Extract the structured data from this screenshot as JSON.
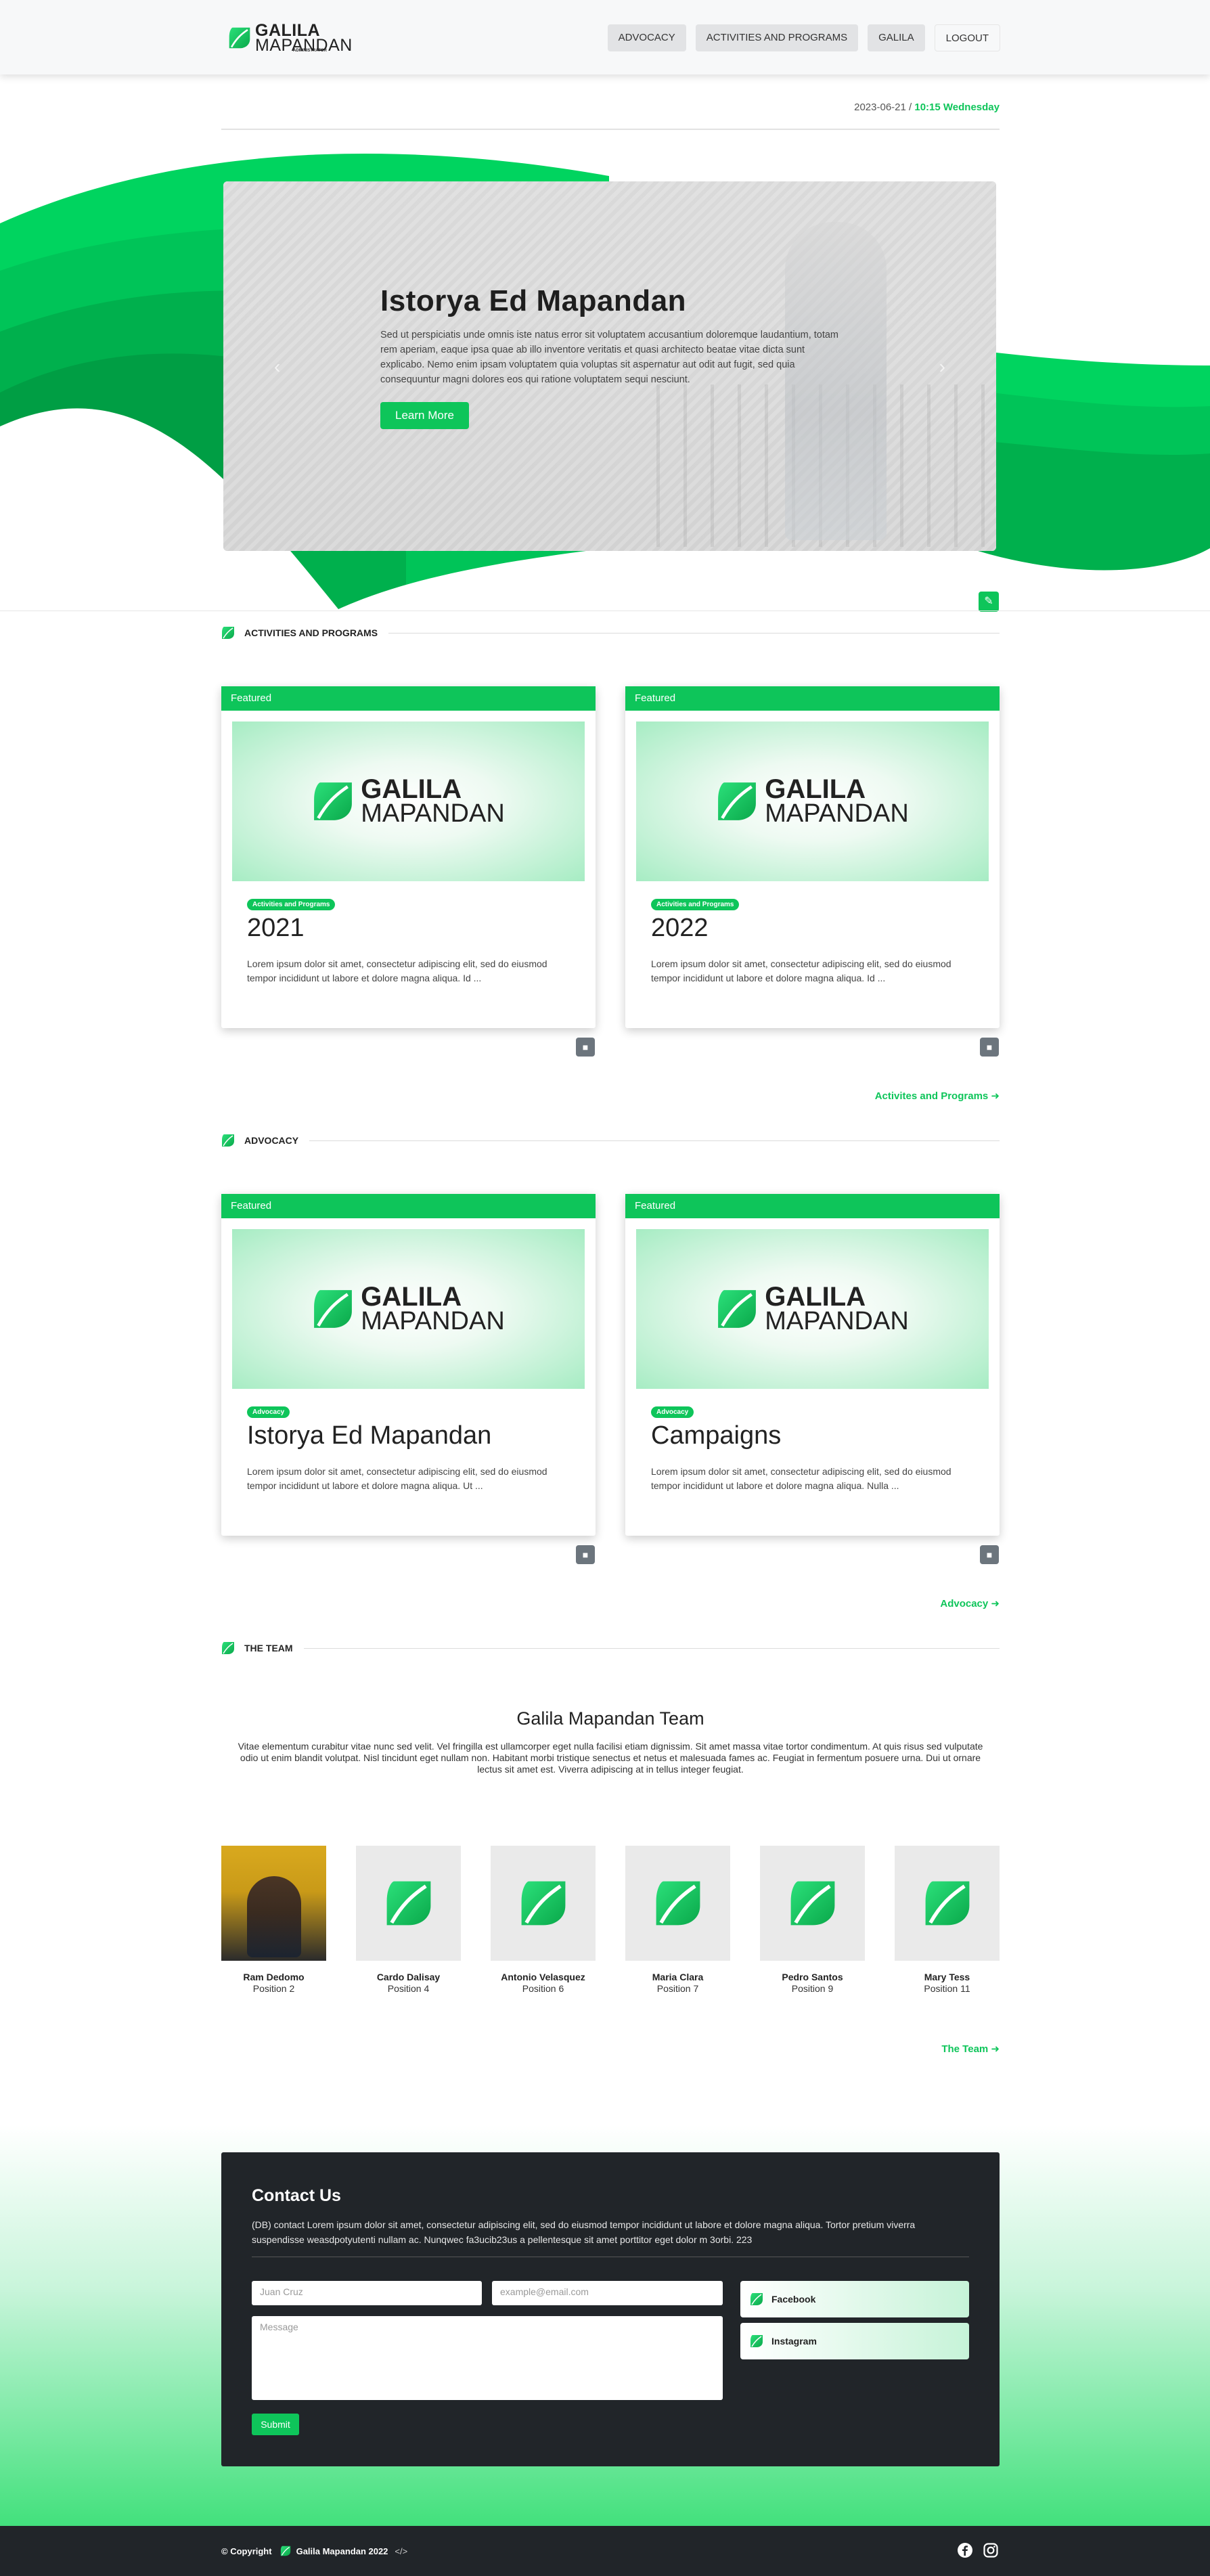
{
  "brand": {
    "line1": "GALILA",
    "line2": "MAPANDAN",
    "sub": "ADMINISTRATOR"
  },
  "nav": {
    "advocacy": "ADVOCACY",
    "activities": "ACTIVITIES AND PROGRAMS",
    "galila": "GALILA",
    "logout": "LOGOUT"
  },
  "datebar": {
    "date": "2023-06-21",
    "sep": " / ",
    "time": "10:15 Wednesday"
  },
  "hero": {
    "title": "Istorya Ed Mapandan",
    "text": "Sed ut perspiciatis unde omnis iste natus error sit voluptatem accusantium doloremque laudantium, totam rem aperiam, eaque ipsa quae ab illo inventore veritatis et quasi architecto beatae vitae dicta sunt explicabo. Nemo enim ipsam voluptatem quia voluptas sit aspernatur aut odit aut fugit, sed quia consequuntur magni dolores eos qui ratione voluptatem sequi nesciunt.",
    "button": "Learn More",
    "prev": "‹",
    "next": "›"
  },
  "sections": {
    "activities": {
      "label": "ACTIVITIES AND PROGRAMS",
      "more": "Activites and Programs",
      "cards": [
        {
          "ribbon": "Featured",
          "logo1": "GALILA",
          "logo2": "MAPANDAN",
          "badge": "Activities and Programs",
          "title": "2021",
          "desc": "Lorem ipsum dolor sit amet, consectetur adipiscing elit, sed do eiusmod tempor incididunt ut labore et dolore magna aliqua. Id ..."
        },
        {
          "ribbon": "Featured",
          "logo1": "GALILA",
          "logo2": "MAPANDAN",
          "badge": "Activities and Programs",
          "title": "2022",
          "desc": "Lorem ipsum dolor sit amet, consectetur adipiscing elit, sed do eiusmod tempor incididunt ut labore et dolore magna aliqua. Id ..."
        }
      ]
    },
    "advocacy": {
      "label": "ADVOCACY",
      "more": "Advocacy",
      "cards": [
        {
          "ribbon": "Featured",
          "logo1": "GALILA",
          "logo2": "MAPANDAN",
          "badge": "Advocacy",
          "title": "Istorya Ed Mapandan",
          "desc": "Lorem ipsum dolor sit amet, consectetur adipiscing elit, sed do eiusmod tempor incididunt ut labore et dolore magna aliqua. Ut ..."
        },
        {
          "ribbon": "Featured",
          "logo1": "GALILA",
          "logo2": "MAPANDAN",
          "badge": "Advocacy",
          "title": "Campaigns",
          "desc": "Lorem ipsum dolor sit amet, consectetur adipiscing elit, sed do eiusmod tempor incididunt ut labore et dolore magna aliqua. Nulla ..."
        }
      ]
    },
    "team": {
      "label": "THE TEAM",
      "title": "Galila Mapandan Team",
      "desc": "Vitae elementum curabitur vitae nunc sed velit. Vel fringilla est ullamcorper eget nulla facilisi etiam dignissim. Sit amet massa vitae tortor condimentum. At quis risus sed vulputate odio ut enim blandit volutpat. Nisl tincidunt eget nullam non. Habitant morbi tristique senectus et netus et malesuada fames ac. Feugiat in fermentum posuere urna. Dui ut ornare lectus sit amet est. Viverra adipiscing at in tellus integer feugiat.",
      "more": "The Team",
      "members": [
        {
          "name": "Ram Dedomo",
          "position": "Position 2"
        },
        {
          "name": "Cardo Dalisay",
          "position": "Position 4"
        },
        {
          "name": "Antonio Velasquez",
          "position": "Position 6"
        },
        {
          "name": "Maria Clara",
          "position": "Position 7"
        },
        {
          "name": "Pedro Santos",
          "position": "Position 9"
        },
        {
          "name": "Mary Tess",
          "position": "Position 11"
        }
      ]
    }
  },
  "contact": {
    "title": "Contact Us",
    "text": "(DB) contact Lorem ipsum dolor sit amet, consectetur adipiscing elit, sed do eiusmod tempor incididunt ut labore et dolore magna aliqua. Tortor pretium viverra suspendisse weasdpotyutenti nullam ac. Nunqwec fa3ucib23us a pellentesque sit amet porttitor eget dolor m 3orbi. 223",
    "name_placeholder": "Juan Cruz",
    "email_placeholder": "example@email.com",
    "message_placeholder": "Message",
    "submit": "Submit",
    "facebook": "Facebook",
    "instagram": "Instagram"
  },
  "footer": {
    "copyright": "© Copyright",
    "brand": "Galila Mapandan 2022"
  },
  "colors": {
    "accent": "#0ec55a",
    "dark": "#212529",
    "nav_bg": "#f7f8f9"
  },
  "icons": {
    "leaf": "leaf-logo-icon",
    "edit": "edit-icon",
    "bookmark": "bookmark-icon",
    "arrow": "arrow-circle-right-icon",
    "facebook": "facebook-icon",
    "instagram": "instagram-icon",
    "code": "code-icon"
  }
}
